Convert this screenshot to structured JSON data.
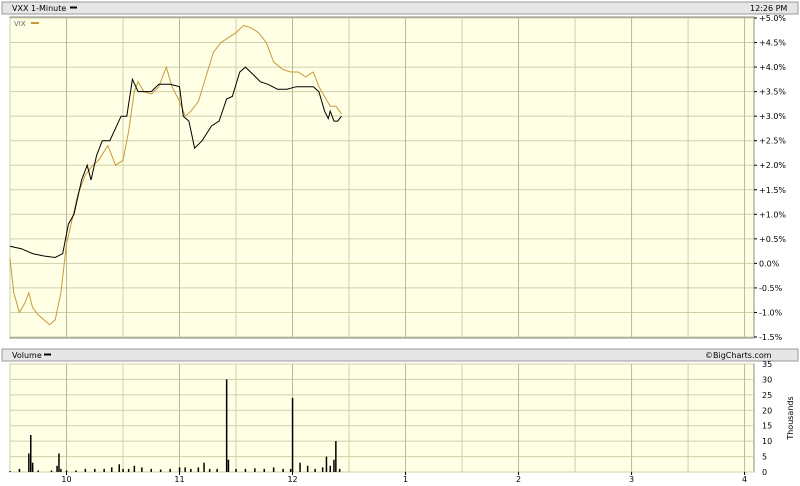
{
  "header": {
    "title": "VXX 1-Minute",
    "time": "12:26 PM"
  },
  "legend": {
    "series_label": "VIX"
  },
  "volume_panel": {
    "title": "Volume",
    "watermark": "©BigCharts.com",
    "axis_unit": "Thousands"
  },
  "colors": {
    "background": "#ffffe6",
    "grid": "#cfd0a8",
    "header_bg": "#e6e6e6",
    "vxx_line": "#000000",
    "vix_line": "#c79a3a",
    "volume": "#000000"
  },
  "chart_data": [
    {
      "type": "line",
      "title": "VXX 1-Minute",
      "x_ticks": [
        "10",
        "11",
        "12",
        "1",
        "2",
        "3",
        "4"
      ],
      "y_ticks": [
        "-1.5%",
        "-1.0%",
        "-0.5%",
        "0.0%",
        "+0.5%",
        "+1.0%",
        "+1.5%",
        "+2.0%",
        "+2.5%",
        "+3.0%",
        "+3.5%",
        "+4.0%",
        "+4.5%",
        "+5.0%"
      ],
      "ylim": [
        -1.5,
        5.0
      ],
      "xlim": [
        "09:30",
        "16:05"
      ],
      "legend_position": "top-left",
      "series": [
        {
          "name": "VXX",
          "points": [
            [
              "09:30",
              0.35
            ],
            [
              "09:36",
              0.3
            ],
            [
              "09:42",
              0.2
            ],
            [
              "09:48",
              0.15
            ],
            [
              "09:54",
              0.12
            ],
            [
              "09:58",
              0.2
            ],
            [
              "10:01",
              0.8
            ],
            [
              "10:04",
              1.0
            ],
            [
              "10:08",
              1.7
            ],
            [
              "10:11",
              2.0
            ],
            [
              "10:13",
              1.7
            ],
            [
              "10:16",
              2.2
            ],
            [
              "10:19",
              2.5
            ],
            [
              "10:23",
              2.5
            ],
            [
              "10:26",
              2.75
            ],
            [
              "10:29",
              3.0
            ],
            [
              "10:32",
              3.0
            ],
            [
              "10:35",
              3.75
            ],
            [
              "10:38",
              3.5
            ],
            [
              "10:41",
              3.5
            ],
            [
              "10:45",
              3.5
            ],
            [
              "10:49",
              3.65
            ],
            [
              "10:55",
              3.65
            ],
            [
              "11:00",
              3.6
            ],
            [
              "11:02",
              3.0
            ],
            [
              "11:05",
              2.9
            ],
            [
              "11:08",
              2.35
            ],
            [
              "11:12",
              2.5
            ],
            [
              "11:17",
              2.8
            ],
            [
              "11:21",
              2.9
            ],
            [
              "11:25",
              3.35
            ],
            [
              "11:28",
              3.4
            ],
            [
              "11:32",
              3.9
            ],
            [
              "11:35",
              4.0
            ],
            [
              "11:39",
              3.85
            ],
            [
              "11:43",
              3.7
            ],
            [
              "11:47",
              3.65
            ],
            [
              "11:52",
              3.55
            ],
            [
              "11:57",
              3.55
            ],
            [
              "12:02",
              3.6
            ],
            [
              "12:07",
              3.6
            ],
            [
              "12:11",
              3.6
            ],
            [
              "12:14",
              3.5
            ],
            [
              "12:17",
              3.1
            ],
            [
              "12:19",
              2.95
            ],
            [
              "12:20",
              3.1
            ],
            [
              "12:22",
              2.9
            ],
            [
              "12:24",
              2.9
            ],
            [
              "12:26",
              3.0
            ]
          ]
        },
        {
          "name": "VIX",
          "points": [
            [
              "09:30",
              0.1
            ],
            [
              "09:32",
              -0.6
            ],
            [
              "09:35",
              -1.0
            ],
            [
              "09:38",
              -0.8
            ],
            [
              "09:40",
              -0.6
            ],
            [
              "09:42",
              -0.9
            ],
            [
              "09:45",
              -1.05
            ],
            [
              "09:48",
              -1.15
            ],
            [
              "09:51",
              -1.25
            ],
            [
              "09:54",
              -1.15
            ],
            [
              "09:57",
              -0.6
            ],
            [
              "10:00",
              0.4
            ],
            [
              "10:03",
              0.9
            ],
            [
              "10:06",
              1.4
            ],
            [
              "10:10",
              1.8
            ],
            [
              "10:14",
              2.0
            ],
            [
              "10:17",
              2.1
            ],
            [
              "10:22",
              2.4
            ],
            [
              "10:26",
              2.0
            ],
            [
              "10:30",
              2.1
            ],
            [
              "10:33",
              2.7
            ],
            [
              "10:36",
              3.5
            ],
            [
              "10:38",
              3.7
            ],
            [
              "10:41",
              3.5
            ],
            [
              "10:45",
              3.45
            ],
            [
              "10:49",
              3.6
            ],
            [
              "10:53",
              4.0
            ],
            [
              "10:56",
              3.6
            ],
            [
              "11:00",
              3.3
            ],
            [
              "11:03",
              3.0
            ],
            [
              "11:06",
              3.1
            ],
            [
              "11:10",
              3.3
            ],
            [
              "11:14",
              3.8
            ],
            [
              "11:18",
              4.3
            ],
            [
              "11:22",
              4.5
            ],
            [
              "11:26",
              4.6
            ],
            [
              "11:30",
              4.7
            ],
            [
              "11:34",
              4.85
            ],
            [
              "11:38",
              4.8
            ],
            [
              "11:42",
              4.7
            ],
            [
              "11:46",
              4.5
            ],
            [
              "11:50",
              4.1
            ],
            [
              "11:55",
              3.95
            ],
            [
              "11:59",
              3.9
            ],
            [
              "12:03",
              3.9
            ],
            [
              "12:07",
              3.8
            ],
            [
              "12:11",
              3.9
            ],
            [
              "12:14",
              3.6
            ],
            [
              "12:17",
              3.4
            ],
            [
              "12:20",
              3.2
            ],
            [
              "12:23",
              3.2
            ],
            [
              "12:26",
              3.05
            ]
          ]
        }
      ]
    },
    {
      "type": "bar",
      "title": "Volume",
      "ylabel": "Thousands",
      "y_ticks": [
        "0",
        "5",
        "10",
        "15",
        "20",
        "25",
        "30",
        "35"
      ],
      "ylim": [
        0,
        35
      ],
      "x": [
        "09:30",
        "09:35",
        "09:40",
        "09:41",
        "09:42",
        "09:45",
        "09:52",
        "09:55",
        "09:56",
        "09:57",
        "10:00",
        "10:05",
        "10:10",
        "10:15",
        "10:20",
        "10:24",
        "10:28",
        "10:30",
        "10:33",
        "10:36",
        "10:40",
        "10:45",
        "10:50",
        "10:55",
        "11:00",
        "11:03",
        "11:06",
        "11:10",
        "11:13",
        "11:16",
        "11:20",
        "11:25",
        "11:26",
        "11:30",
        "11:35",
        "11:40",
        "11:45",
        "11:50",
        "11:55",
        "11:59",
        "12:00",
        "12:04",
        "12:08",
        "12:12",
        "12:16",
        "12:18",
        "12:20",
        "12:22",
        "12:23",
        "12:25"
      ],
      "values": [
        0.3,
        1,
        6,
        12,
        3,
        0.5,
        0.5,
        2,
        6,
        1,
        0.5,
        0.5,
        1,
        1,
        1,
        1.5,
        2.5,
        1,
        1,
        2,
        1.5,
        1,
        0.8,
        1,
        1.5,
        1.5,
        1,
        1.5,
        3,
        1,
        1,
        30,
        4,
        1,
        1,
        1.2,
        1,
        1.5,
        1,
        1,
        24,
        3,
        2,
        1,
        1.5,
        5,
        2,
        4,
        10,
        1
      ]
    }
  ]
}
